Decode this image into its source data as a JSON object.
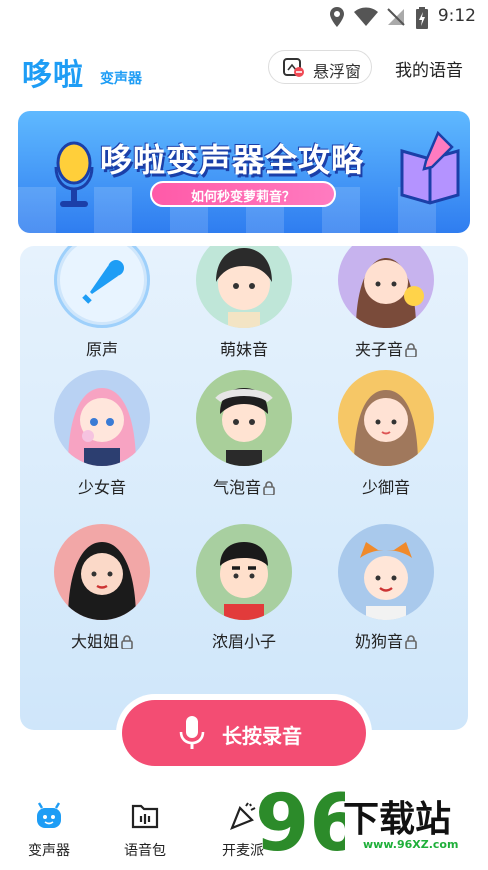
{
  "status_bar": {
    "time": "9:12"
  },
  "header": {
    "logo_main": "哆啦",
    "logo_sub": "变声器",
    "float_window_label": "悬浮窗",
    "my_voice_label": "我的语音"
  },
  "banner": {
    "title": "哆啦变声器全攻略",
    "subtitle": "如何秒变萝莉音？"
  },
  "voices": [
    {
      "name": "原声",
      "locked": false,
      "selected": true
    },
    {
      "name": "萌妹音",
      "locked": false,
      "selected": false
    },
    {
      "name": "夹子音",
      "locked": true,
      "selected": false
    },
    {
      "name": "少女音",
      "locked": false,
      "selected": false
    },
    {
      "name": "气泡音",
      "locked": true,
      "selected": false
    },
    {
      "name": "少御音",
      "locked": false,
      "selected": false
    },
    {
      "name": "大姐姐",
      "locked": true,
      "selected": false
    },
    {
      "name": "浓眉小子",
      "locked": false,
      "selected": false
    },
    {
      "name": "奶狗音",
      "locked": true,
      "selected": false
    }
  ],
  "record_button": {
    "label": "长按录音"
  },
  "nav": {
    "items": [
      {
        "label": "变声器",
        "active": true
      },
      {
        "label": "语音包",
        "active": false
      },
      {
        "label": "开麦派"
      }
    ]
  },
  "watermark": {
    "text": "下载站",
    "number": "96",
    "url": "www.96XZ.com"
  },
  "colors": {
    "accent": "#1e9df5",
    "record": "#f34d73",
    "panel": "#dcedfb"
  }
}
